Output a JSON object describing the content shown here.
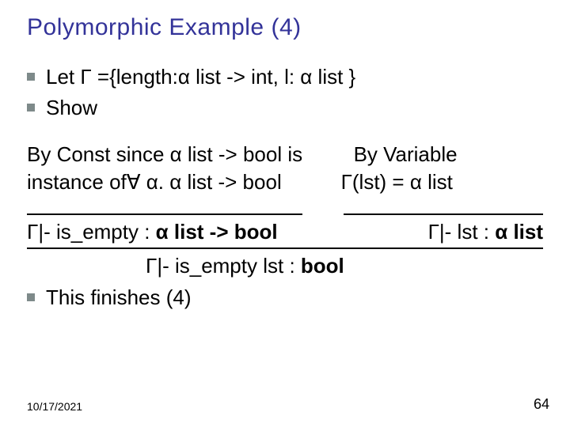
{
  "title": "Polymorphic Example (4)",
  "bullets": {
    "let": "Let  Γ ={length:α list -> int,  l: α list }",
    "show": "Show"
  },
  "midLeft1": "By Const since α list -> bool is",
  "midLeft2a": "instance of",
  "midLeft2b": "∀ α. α list -> bool",
  "midRight1": "By Variable",
  "midRight2": "Γ(lst) = α list",
  "proof": {
    "leftConcl1": "Γ|- is_empty : ",
    "leftConcl2": "α list -> bool",
    "rightConcl1": "Γ|- lst : ",
    "rightConcl2": "α list",
    "finalConcl1": "Γ|- is_empty lst : ",
    "finalConcl2": "bool"
  },
  "finish": "This finishes (4)",
  "footer": {
    "date": "10/17/2021",
    "page": "64"
  }
}
